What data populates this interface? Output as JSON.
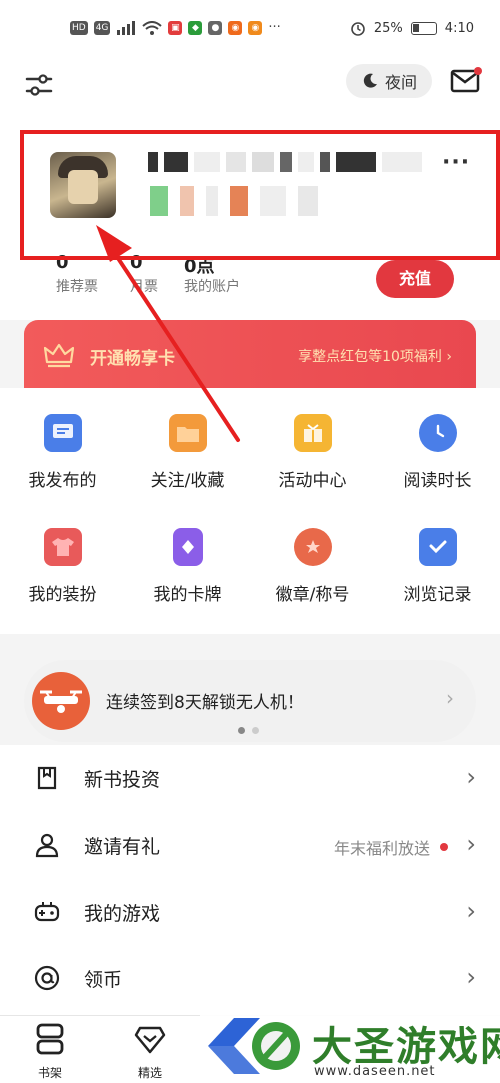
{
  "status_bar": {
    "left_chips": [
      "HD",
      "4G"
    ],
    "battery": "25%",
    "time": "4:10"
  },
  "header": {
    "night_label": "夜间",
    "icons": [
      "settings-sliders-icon",
      "moon-icon",
      "mail-icon"
    ]
  },
  "profile": {
    "more": "···",
    "stats": [
      {
        "num": "0",
        "label": "推荐票"
      },
      {
        "num": "0",
        "label": "月票"
      },
      {
        "num": "0点",
        "label": "我的账户"
      }
    ],
    "recharge_label": "充值"
  },
  "vip": {
    "title": "开通畅享卡",
    "benefit": "享整点红包等10项福利",
    "chevron": "›"
  },
  "grid": [
    {
      "label": "我发布的",
      "icon": "message-icon",
      "color": "#4a7ee8"
    },
    {
      "label": "关注/收藏",
      "icon": "folder-icon",
      "color": "#f39a3b"
    },
    {
      "label": "活动中心",
      "icon": "gift-icon",
      "color": "#f5b533"
    },
    {
      "label": "阅读时长",
      "icon": "clock-icon",
      "color": "#4a7ee8"
    },
    {
      "label": "我的装扮",
      "icon": "tshirt-icon",
      "color": "#e85a5a"
    },
    {
      "label": "我的卡牌",
      "icon": "card-icon",
      "color": "#8b5ee8"
    },
    {
      "label": "徽章/称号",
      "icon": "medal-icon",
      "color": "#e8694a"
    },
    {
      "label": "浏览记录",
      "icon": "shield-check-icon",
      "color": "#4a7ee8"
    }
  ],
  "sign_banner": {
    "text": "连续签到8天解锁无人机！",
    "chevron": "›"
  },
  "list": [
    {
      "label": "新书投资",
      "extra": "",
      "icon": "bookmark-icon"
    },
    {
      "label": "邀请有礼",
      "extra": "年末福利放送",
      "icon": "user-icon"
    },
    {
      "label": "我的游戏",
      "extra": "",
      "icon": "gamepad-icon"
    },
    {
      "label": "领币",
      "extra": "",
      "icon": "at-coin-icon"
    }
  ],
  "tabs": [
    {
      "label": "书架",
      "icon": "bookshelf-icon"
    },
    {
      "label": "精选",
      "icon": "diamond-icon"
    }
  ],
  "watermark": {
    "title": "大圣游戏网",
    "url": "www.daseen.net"
  },
  "colors": {
    "accent": "#e2383f",
    "highlight_box": "#e62020",
    "watermark_green": "#2f7e2a"
  }
}
